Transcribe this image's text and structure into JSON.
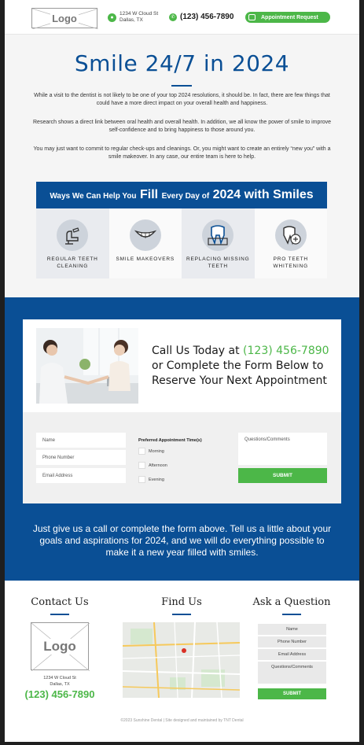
{
  "header": {
    "logo": "Logo",
    "address_line1": "1234 W Cloud St",
    "address_line2": "Dallas, TX",
    "phone": "(123) 456-7890",
    "appointment_button": "Appointment Request"
  },
  "intro": {
    "title": "Smile 24/7 in 2024",
    "paragraphs": [
      "While a visit to the dentist is not likely to be one of your top 2024 resolutions, it should be. In fact, there are few things that could have a more direct impact on your overall health and happiness.",
      "Research shows a direct link between oral health and overall health. In addition, we all know the power of smile to improve self-confidence and to bring happiness to those around you.",
      "You may just want to commit to regular check-ups and cleanings. Or, you might want to create an entirely “new you” with a smile makeover. In any case, our entire team is here to help."
    ],
    "banner": {
      "part1": "Ways We Can Help You",
      "part2": "Fill",
      "part3": "Every Day of",
      "part4": "2024 with Smiles"
    },
    "services": [
      {
        "label": "REGULAR TEETH CLEANING",
        "icon": "dental-chair-icon"
      },
      {
        "label": "SMILE MAKEOVERS",
        "icon": "smile-icon"
      },
      {
        "label": "REPLACING MISSING TEETH",
        "icon": "tooth-implant-icon"
      },
      {
        "label": "PRO TEETH WHITENING",
        "icon": "tooth-whitening-icon"
      }
    ]
  },
  "cta": {
    "line1_prefix": "Call Us Today at",
    "line1_phone": "(123) 456-7890",
    "line2": "or Complete the Form Below to",
    "line3": "Reserve Your Next Appointment"
  },
  "form": {
    "name_placeholder": "Name",
    "phone_placeholder": "Phone Number",
    "email_placeholder": "Email Address",
    "preferred_label": "Preferred Appointment Time(s)",
    "times": [
      "Morning",
      "Afternoon",
      "Evening"
    ],
    "questions_placeholder": "Questions/Comments",
    "submit": "SUBMIT"
  },
  "blue_text": "Just give us a call or complete the form above. Tell us a little about your goals and aspirations for 2024, and we will do everything possible to make it a new year filled with smiles.",
  "footer": {
    "contact_heading": "Contact Us",
    "find_heading": "Find Us",
    "ask_heading": "Ask a Question",
    "logo": "Logo",
    "address_line1": "1234 W Cloud St",
    "address_line2": "Dallas, TX",
    "phone": "(123) 456-7890",
    "ask_fields": [
      "Name",
      "Phone Number",
      "Email Address",
      "Questions/Comments"
    ],
    "submit": "SUBMIT",
    "copyright": "©2023 Sunshine Dental  |  Site designed and maintained by TNT Dental"
  },
  "colors": {
    "brand_blue": "#0a4f95",
    "brand_green": "#4cb748"
  }
}
